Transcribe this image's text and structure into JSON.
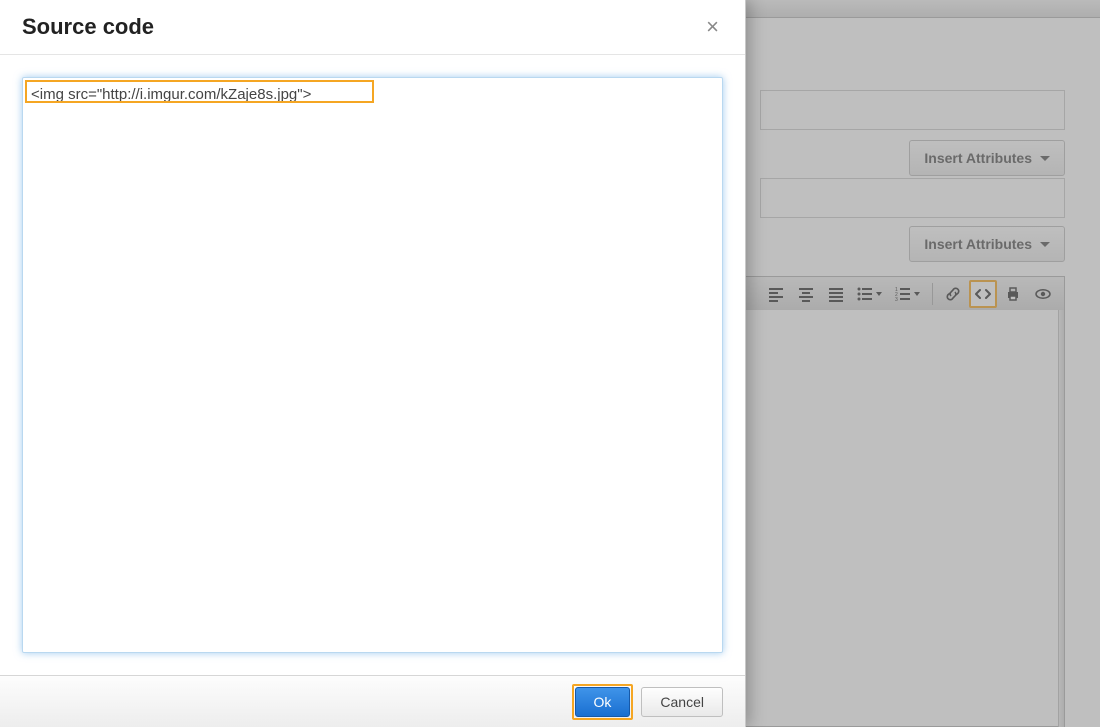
{
  "modal": {
    "title": "Source code",
    "source_text": "<img src=\"http://i.imgur.com/kZaje8s.jpg\">",
    "ok_label": "Ok",
    "cancel_label": "Cancel",
    "close_label": "×"
  },
  "bg": {
    "insert_attributes_label": "Insert Attributes"
  },
  "toolbar": {
    "icons": [
      "align-left",
      "align-center",
      "align-justify",
      "bullet-list",
      "number-list",
      "link",
      "source-code",
      "print",
      "preview"
    ]
  },
  "highlights": {
    "source_text": true,
    "ok_button": true,
    "source_code_toolbar_btn": true
  },
  "colors": {
    "highlight": "#f5a623",
    "primary": "#2378d8"
  }
}
